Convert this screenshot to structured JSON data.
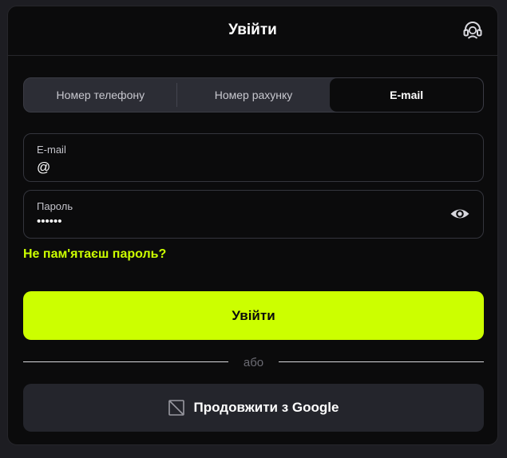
{
  "header": {
    "title": "Увійти",
    "support_icon": "headset-icon"
  },
  "tabs": [
    {
      "label": "Номер телефону",
      "active": false
    },
    {
      "label": "Номер рахунку",
      "active": false
    },
    {
      "label": "E-mail",
      "active": true
    }
  ],
  "email_field": {
    "label": "E-mail",
    "value": "@"
  },
  "password_field": {
    "label": "Пароль",
    "value": "••••••",
    "toggle_icon": "eye-icon"
  },
  "forgot_link": "Не пам'ятаєш пароль?",
  "login_button": "Увійти",
  "divider_text": "або",
  "google_button": {
    "label": "Продовжити з Google",
    "icon": "broken-image-icon"
  },
  "colors": {
    "accent": "#ccff00",
    "background": "#0b0b0c",
    "page": "#1d1d22"
  }
}
